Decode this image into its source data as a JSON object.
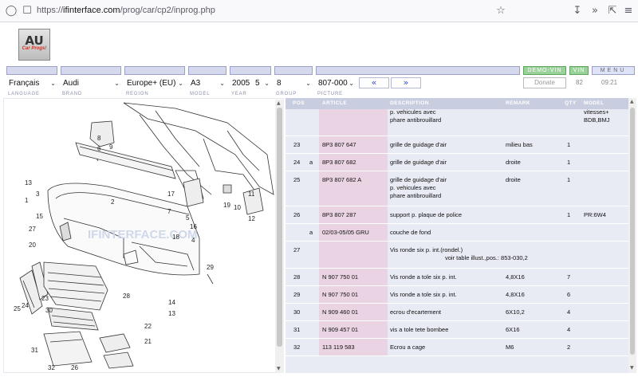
{
  "browser": {
    "url_prefix": "https://",
    "url_domain": "ifinterface.com",
    "url_path": "/prog/car/cp2/inprog.php"
  },
  "logo": {
    "text": "AU",
    "tagline": "Car Progs!"
  },
  "header": {
    "demo_vin": "DEMO-VIN",
    "vin": "VIN",
    "menu": "MENU"
  },
  "selectors": {
    "language": "Français",
    "brand": "Audi",
    "region": "Europe+ (EU)",
    "model": "A3",
    "year": "2005",
    "year_month": "5",
    "group": "8",
    "picture": "807-000",
    "prev": "«",
    "next": "»",
    "donate": "Donate",
    "count": "82",
    "time": "09:21"
  },
  "labels": {
    "language": "LANGUAGE",
    "brand": "BRAND",
    "region": "REGION",
    "model": "MODEL",
    "year": "YEAR",
    "group": "GROUP",
    "picture": "PICTURE"
  },
  "diagram": {
    "watermark": "IFINTERFACE.COM",
    "callouts": [
      "8",
      "6",
      "9",
      "13",
      "3",
      "1",
      "15",
      "2",
      "17",
      "7",
      "5",
      "19",
      "18",
      "16",
      "4",
      "10",
      "11",
      "12",
      "27",
      "20",
      "23",
      "25",
      "29",
      "28",
      "14",
      "13",
      "24",
      "21",
      "22",
      "30",
      "31",
      "32",
      "26"
    ]
  },
  "table": {
    "headers": {
      "pos": "POS",
      "article": "ARTICLE",
      "description": "DESCRIPTION",
      "remark": "REMARK",
      "qty": "QTY",
      "model": "MODEL"
    },
    "rows": [
      {
        "pos": "",
        "prefix": "",
        "article": "",
        "desc1": "p. vehicules avec",
        "desc2": "phare antibrouillard",
        "desc3": "",
        "remark": "",
        "qty": "",
        "model": "vitesses+",
        "model2": "BDB,BMJ"
      },
      {
        "pos": "23",
        "prefix": "",
        "article": "8P3 807 647",
        "desc1": "grille de guidage d'air",
        "desc2": "",
        "desc3": "",
        "remark": "milieu bas",
        "qty": "1",
        "model": "",
        "model2": ""
      },
      {
        "pos": "24",
        "prefix": "a",
        "article": "8P3 807 682",
        "desc1": "grille de guidage d'air",
        "desc2": "",
        "desc3": "",
        "remark": "droite",
        "qty": "1",
        "model": "",
        "model2": ""
      },
      {
        "pos": "25",
        "prefix": "",
        "article": "8P3 807 682 A",
        "desc1": "grille de guidage d'air",
        "desc2": "p. vehicules avec",
        "desc3": "phare antibrouillard",
        "remark": "droite",
        "qty": "1",
        "model": "",
        "model2": ""
      },
      {
        "pos": "26",
        "prefix": "",
        "article": "8P3 807 287",
        "desc1": "support p. plaque de police",
        "desc2": "",
        "desc3": "",
        "remark": "",
        "qty": "1",
        "model": "PR:6W4",
        "model2": ""
      },
      {
        "pos": "",
        "prefix": "a",
        "article": "02/03-05/05     GRU",
        "desc1": "couche de fond",
        "desc2": "",
        "desc3": "",
        "remark": "",
        "qty": "",
        "model": "",
        "model2": ""
      },
      {
        "pos": "27",
        "prefix": "",
        "article": "",
        "desc1": "Vis ronde six p. int.(rondel.)",
        "desc2": "voir table illust.,pos.: 853-030,2",
        "desc3": "",
        "remark": "",
        "qty": "",
        "model": "",
        "model2": ""
      },
      {
        "pos": "28",
        "prefix": "",
        "article": "N   907 750 01",
        "desc1": "Vis ronde a tole six p. int.",
        "desc2": "",
        "desc3": "",
        "remark": "4,8X16",
        "qty": "7",
        "model": "",
        "model2": ""
      },
      {
        "pos": "29",
        "prefix": "",
        "article": "N   907 750 01",
        "desc1": "Vis ronde a tole six p. int.",
        "desc2": "",
        "desc3": "",
        "remark": "4,8X16",
        "qty": "6",
        "model": "",
        "model2": ""
      },
      {
        "pos": "30",
        "prefix": "",
        "article": "N   909 460 01",
        "desc1": "ecrou d'ecartement",
        "desc2": "",
        "desc3": "",
        "remark": "6X10,2",
        "qty": "4",
        "model": "",
        "model2": ""
      },
      {
        "pos": "31",
        "prefix": "",
        "article": "N   909 457 01",
        "desc1": "vis a tole tete bombee",
        "desc2": "",
        "desc3": "",
        "remark": "6X16",
        "qty": "4",
        "model": "",
        "model2": ""
      },
      {
        "pos": "32",
        "prefix": "",
        "article": "113 119 583",
        "desc1": "Ecrou a cage",
        "desc2": "",
        "desc3": "",
        "remark": "M6",
        "qty": "2",
        "model": "",
        "model2": ""
      }
    ]
  },
  "colors": {
    "header_row": "#c9cde0",
    "row_bg": "#e8eaf4",
    "article_bg": "#ead3e3",
    "demo_green": "#9bd29b",
    "link_blue": "#3550c8"
  }
}
